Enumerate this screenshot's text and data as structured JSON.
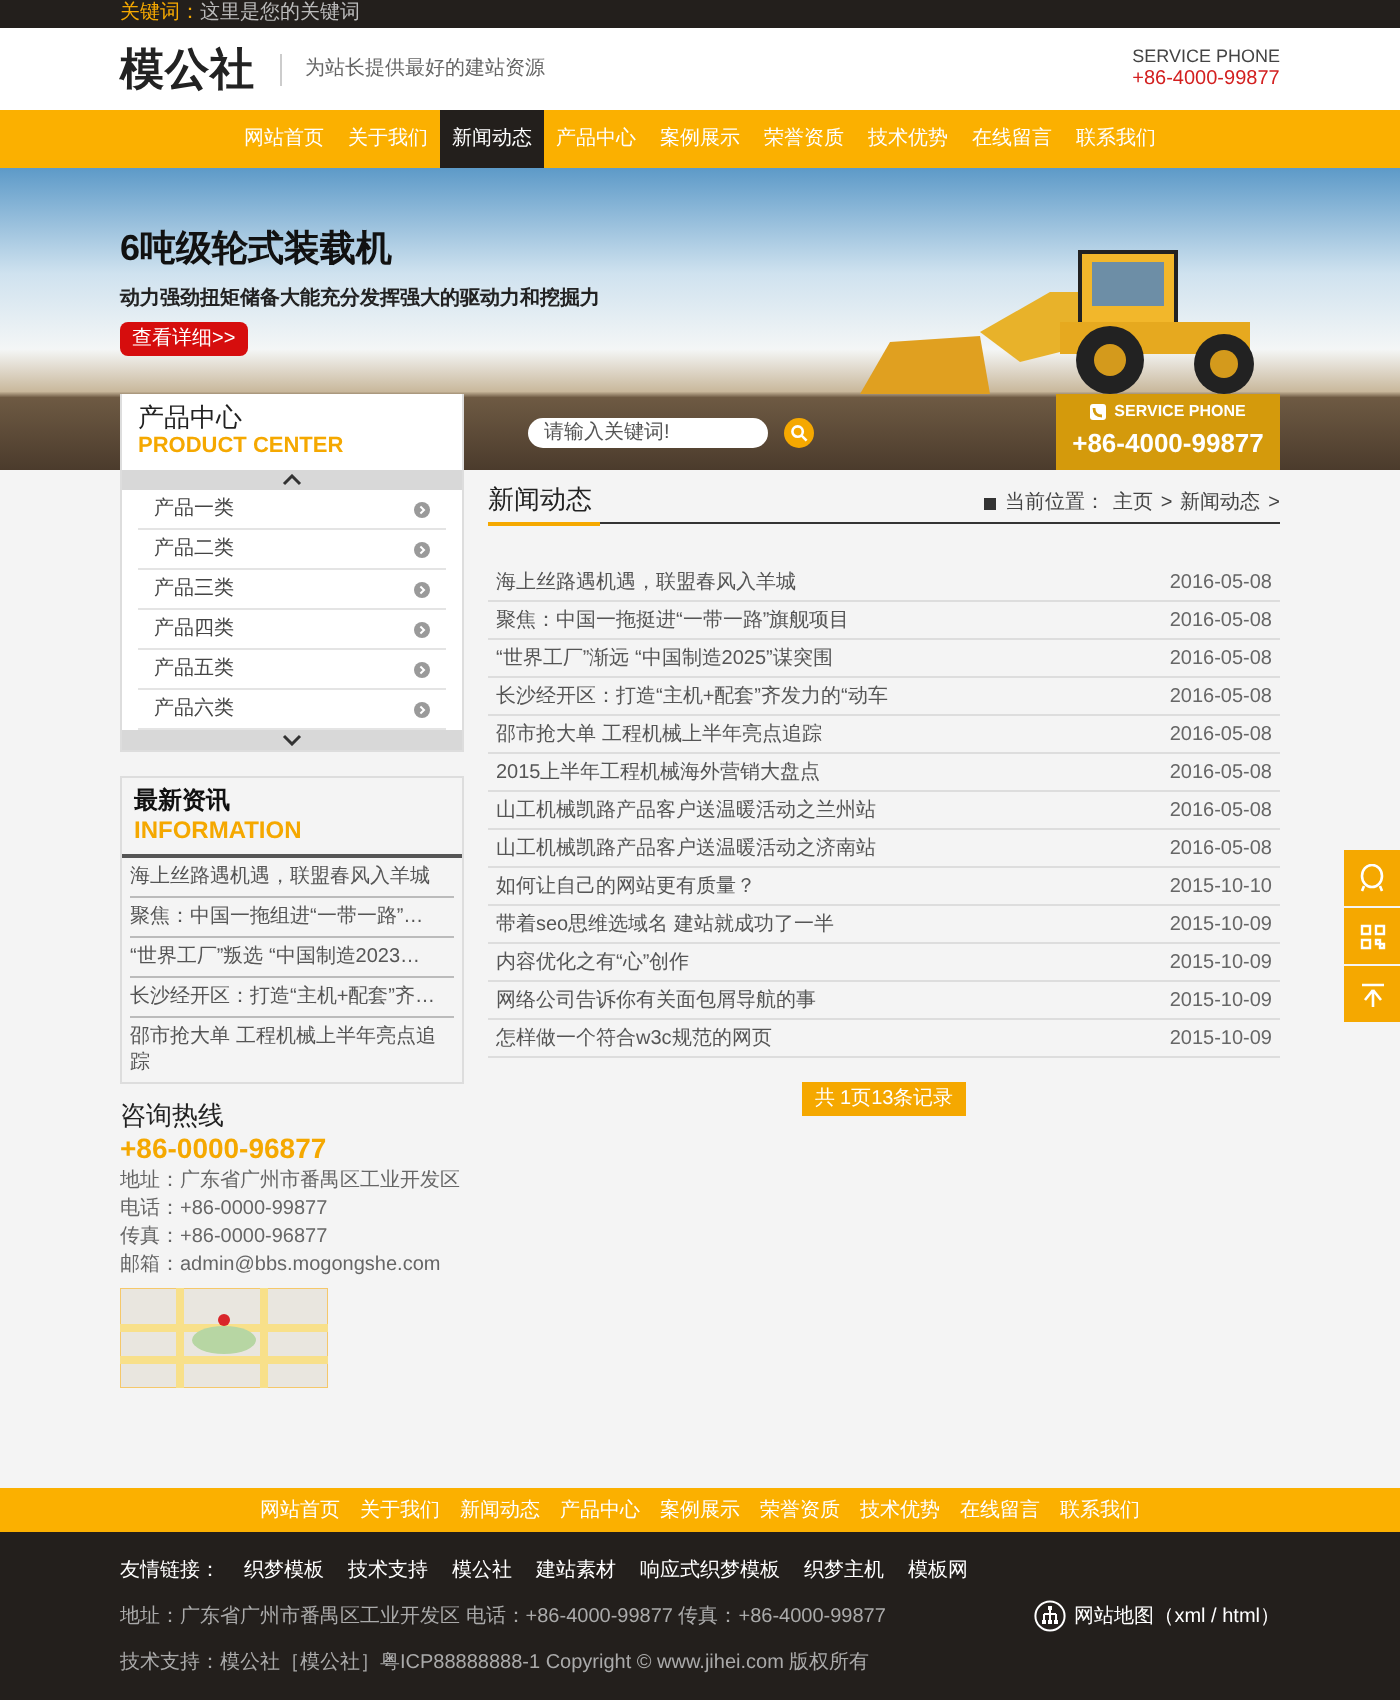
{
  "top_bar": {
    "label": "关键词：",
    "text": "这里是您的关键词"
  },
  "header": {
    "logo": "模公社",
    "tagline": "为站长提供最好的建站资源",
    "service_label": "SERVICE PHONE",
    "service_phone": "+86-4000-99877"
  },
  "nav": [
    {
      "label": "网站首页",
      "selected": false
    },
    {
      "label": "关于我们",
      "selected": false
    },
    {
      "label": "新闻动态",
      "selected": true
    },
    {
      "label": "产品中心",
      "selected": false
    },
    {
      "label": "案例展示",
      "selected": false
    },
    {
      "label": "荣誉资质",
      "selected": false
    },
    {
      "label": "技术优势",
      "selected": false
    },
    {
      "label": "在线留言",
      "selected": false
    },
    {
      "label": "联系我们",
      "selected": false
    }
  ],
  "banner": {
    "title": "6吨级轮式装载机",
    "subtitle": "动力强劲扭矩储备大能充分发挥强大的驱动力和挖掘力",
    "button": "查看详细>>"
  },
  "search": {
    "placeholder": "请输入关键词!"
  },
  "banner_phone": {
    "label": "SERVICE PHONE",
    "phone": "+86-4000-99877"
  },
  "product_center": {
    "title": "产品中心",
    "subtitle": "PRODUCT CENTER",
    "items": [
      "产品一类",
      "产品二类",
      "产品三类",
      "产品四类",
      "产品五类",
      "产品六类"
    ]
  },
  "information": {
    "title": "最新资讯",
    "subtitle": "INFORMATION",
    "items": [
      "海上丝路遇机遇，联盟春风入羊城",
      "聚焦：中国一拖组进“一带一路”…",
      "“世界工厂”叛选 “中国制造2023…",
      "长沙经开区：打造“主机+配套”齐…",
      "邵市抢大单 工程机械上半年亮点追踪"
    ]
  },
  "hotline": {
    "title": "咨询热线",
    "phone": "+86-0000-96877",
    "lines": [
      "地址：广东省广州市番禺区工业开发区",
      "电话：+86-0000-99877",
      "传真：+86-0000-96877",
      "邮箱：admin@bbs.mogongshe.com"
    ]
  },
  "news": {
    "title": "新闻动态",
    "breadcrumb": {
      "label": "当前位置：",
      "links": [
        "主页",
        "新闻动态"
      ],
      "separator": ">"
    },
    "rows": [
      {
        "title": "海上丝路遇机遇，联盟春风入羊城",
        "date": "2016-05-08"
      },
      {
        "title": "聚焦：中国一拖挺进“一带一路”旗舰项目",
        "date": "2016-05-08"
      },
      {
        "title": "“世界工厂”渐远 “中国制造2025”谋突围",
        "date": "2016-05-08"
      },
      {
        "title": "长沙经开区：打造“主机+配套”齐发力的“动车",
        "date": "2016-05-08"
      },
      {
        "title": "邵市抢大单 工程机械上半年亮点追踪",
        "date": "2016-05-08"
      },
      {
        "title": "2015上半年工程机械海外营销大盘点",
        "date": "2016-05-08"
      },
      {
        "title": "山工机械凯路产品客户送温暖活动之兰州站",
        "date": "2016-05-08"
      },
      {
        "title": "山工机械凯路产品客户送温暖活动之济南站",
        "date": "2016-05-08"
      },
      {
        "title": "如何让自己的网站更有质量？",
        "date": "2015-10-10"
      },
      {
        "title": "带着seo思维选域名 建站就成功了一半",
        "date": "2015-10-09"
      },
      {
        "title": "内容优化之有“心”创作",
        "date": "2015-10-09"
      },
      {
        "title": "网络公司告诉你有关面包屑导航的事",
        "date": "2015-10-09"
      },
      {
        "title": "怎样做一个符合w3c规范的网页",
        "date": "2015-10-09"
      }
    ],
    "pagination": "共 1页13条记录"
  },
  "footer_nav": [
    "网站首页",
    "关于我们",
    "新闻动态",
    "产品中心",
    "案例展示",
    "荣誉资质",
    "技术优势",
    "在线留言",
    "联系我们"
  ],
  "footer": {
    "links_label": "友情链接：",
    "links": [
      "织梦模板",
      "技术支持",
      "模公社",
      "建站素材",
      "响应式织梦模板",
      "织梦主机",
      "模板网"
    ],
    "address": "地址：广东省广州市番禺区工业开发区  电话：+86-4000-99877 传真：+86-4000-99877",
    "copyright": "技术支持：模公社［模公社］粤ICP88888888-1  Copyright © www.jihei.com 版权所有",
    "sitemap": "网站地图（xml / html）"
  }
}
